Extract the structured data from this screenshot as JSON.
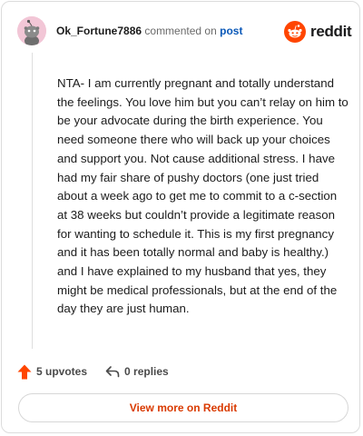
{
  "comment": {
    "author": "Ok_Fortune7886",
    "action_text": "commented on",
    "target_link": "post",
    "body": "NTA- I am currently pregnant and totally understand the feelings. You love him but you can’t relay on him to be your advocate during the birth experience. You need someone there who will back up your choices and support you. Not cause additional stress. I have had my fair share of pushy doctors (one just tried about a week ago to get me to commit to a c-section at 38 weeks but couldn’t provide a legitimate reason for wanting to schedule it. This is my first pregnancy and it has been totally normal and baby is healthy.) and I have explained to my husband that yes, they might be medical professionals, but at the end of the day they are just human."
  },
  "brand": {
    "name": "reddit",
    "icon": "reddit-logo-icon",
    "color": "#ff4500"
  },
  "actions": {
    "upvotes": "5 upvotes",
    "replies": "0 replies"
  },
  "footer": {
    "view_more": "View more on Reddit"
  },
  "colors": {
    "accent": "#ff4500",
    "link": "#0a58b8",
    "avatar_bg": "#f2c6d6"
  }
}
